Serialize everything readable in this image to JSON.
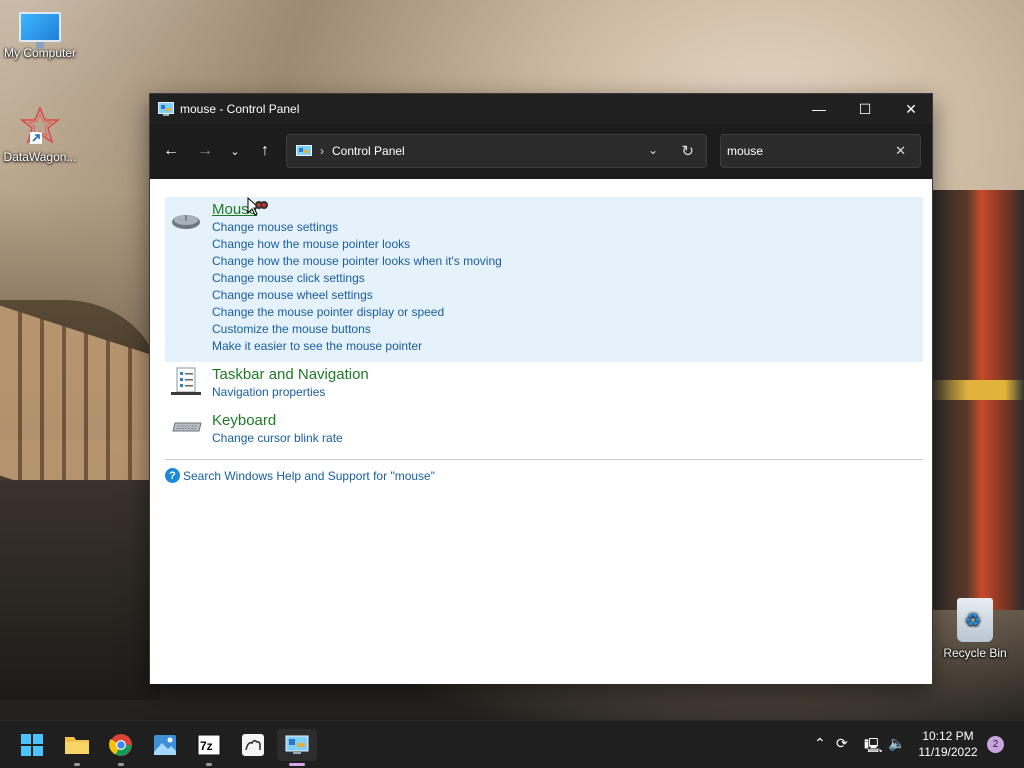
{
  "desktop": {
    "icons": [
      {
        "label": "My Computer"
      },
      {
        "label": "DataWagon..."
      },
      {
        "label": "Recycle Bin"
      }
    ]
  },
  "window": {
    "title": "mouse - Control Panel",
    "breadcrumb": "Control Panel",
    "search": {
      "value": "mouse"
    },
    "results": [
      {
        "title": "Mouse",
        "links": [
          "Change mouse settings",
          "Change how the mouse pointer looks",
          "Change how the mouse pointer looks when it's moving",
          "Change mouse click settings",
          "Change mouse wheel settings",
          "Change the mouse pointer display or speed",
          "Customize the mouse buttons",
          "Make it easier to see the mouse pointer"
        ]
      },
      {
        "title": "Taskbar and Navigation",
        "links": [
          "Navigation properties"
        ]
      },
      {
        "title": "Keyboard",
        "links": [
          "Change cursor blink rate"
        ]
      }
    ],
    "help_text": "Search Windows Help and Support for \"mouse\""
  },
  "taskbar": {
    "apps": [
      "start",
      "file-explorer",
      "chrome",
      "photos",
      "7-zip",
      "perl",
      "control-panel"
    ],
    "clock": {
      "time": "10:12 PM",
      "date": "11/19/2022"
    },
    "notification_count": "2"
  },
  "colors": {
    "accent": "#1a5fa3",
    "result_title": "#1e7b25",
    "selected_bg": "#e5f1fb",
    "titlebar": "#202020"
  }
}
